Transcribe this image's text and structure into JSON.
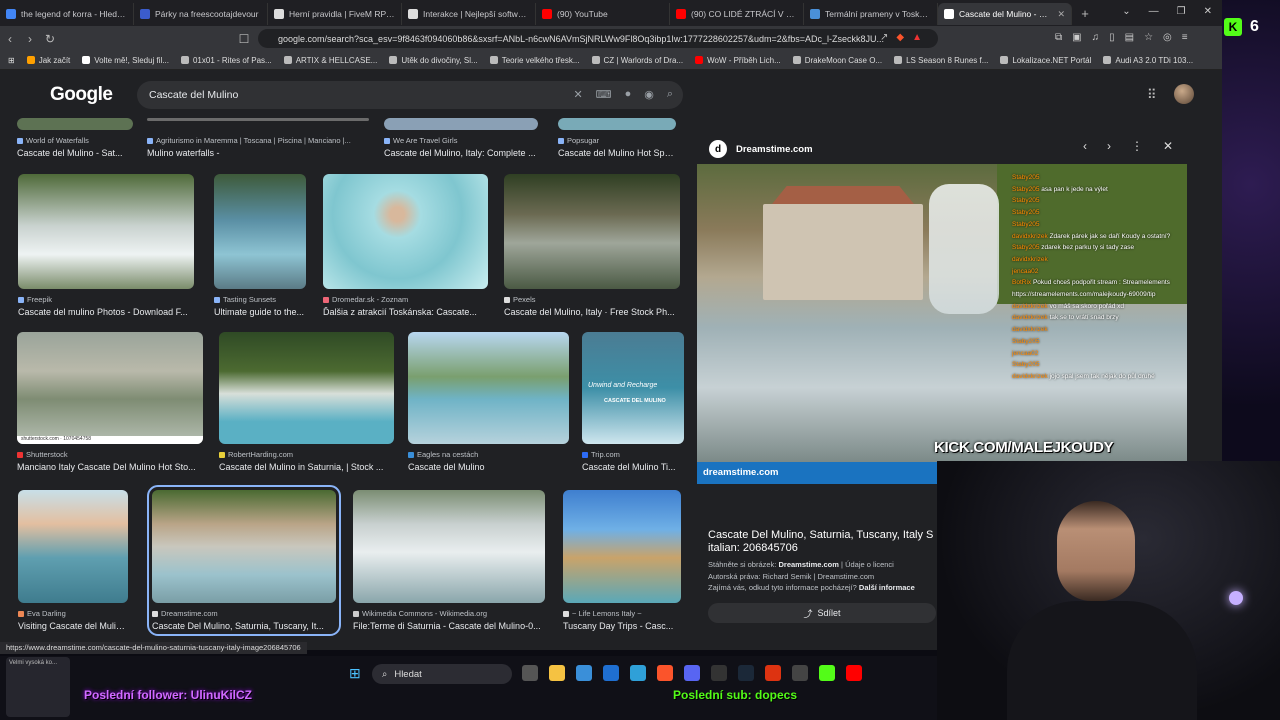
{
  "tabs": [
    {
      "title": "the legend of korra - Hledat G",
      "color": "#4285f4"
    },
    {
      "title": "Párky na freescootajdevour",
      "color": "#3b5ccc"
    },
    {
      "title": "Herní pravidla | FiveM RP - Ge",
      "color": "#dddddd"
    },
    {
      "title": "Interakce | Nejlepší software p",
      "color": "#dddddd"
    },
    {
      "title": "(90) YouTube",
      "color": "#ff0000"
    },
    {
      "title": "(90) CO LIDÉ ZTRÁCÍ V OPUŠT",
      "color": "#ff0000"
    },
    {
      "title": "Termální prameny v Toskánsk",
      "color": "#4a90d9"
    },
    {
      "title": "Cascate del Mulino - Hled",
      "color": "#ffffff",
      "active": true
    }
  ],
  "address": {
    "url": "google.com/search?sca_esv=9f8463f094060b86&sxsrf=ANbL-n6cwN6AVmSjNRLWw9Fl8Oq3ibp1Iw:1777228602257&udm=2&fbs=ADc_l-Zseckk8JU..."
  },
  "bookmarks": [
    "Jak začít",
    "Volte mě!, Sleduj fil...",
    "01x01 - Rites of Pas...",
    "ARTIX & HELLCASE...",
    "Utěk do divočiny, Sl...",
    "Teorie velkého třesk...",
    "CZ | Warlords of Dra...",
    "WoW - Příběh Lich...",
    "DrakeMoon Case O...",
    "LS Season 8 Runes f...",
    "Lokalizace.NET Portál",
    "Audi A3 2.0 TDi 103..."
  ],
  "google": {
    "logo": "Google",
    "query": "Cascate del Mulino"
  },
  "results_top": [
    {
      "source": "World of Waterfalls",
      "title": "Cascate del Mulino - Sat..."
    },
    {
      "source": "Agriturismo in Maremma | Toscana | Piscina | Manciano |...",
      "title": "Mulino waterfalls -"
    },
    {
      "source": "We Are Travel Girls",
      "title": "Cascate del Mulino, Italy: Complete ..."
    },
    {
      "source": "Popsugar",
      "title": "Cascate del Mulino Hot Spri..."
    }
  ],
  "results_row1": [
    {
      "source": "Freepik",
      "title": "Cascate del mulino Photos - Download F..."
    },
    {
      "source": "Tasting Sunsets",
      "title": "Ultimate guide to the..."
    },
    {
      "source": "Dromedar.sk - Zoznam",
      "title": "Ďalšia z atrakcií Toskánska: Cascate..."
    },
    {
      "source": "Pexels",
      "title": "Cascate del Mulino, Italy · Free Stock Ph..."
    }
  ],
  "results_row2": [
    {
      "source": "Shutterstock",
      "title": "Manciano Italy Cascate Del Mulino Hot Sto..."
    },
    {
      "source": "RobertHarding.com",
      "title": "Cascate del Mulino in Saturnia, | Stock ..."
    },
    {
      "source": "Eagles na cestách",
      "title": "Cascate del Mulino"
    },
    {
      "source": "Trip.com",
      "title": "Cascate del Mulino Ti..."
    }
  ],
  "results_row3": [
    {
      "source": "Eva Darling",
      "title": "Visiting Cascate del Mulin..."
    },
    {
      "source": "Dreamstime.com",
      "title": "Cascate Del Mulino, Saturnia, Tuscany, It..."
    },
    {
      "source": "Wikimedia Commons - Wikimedia.org",
      "title": "File:Terme di Saturnia - Cascate del Mulino-0..."
    },
    {
      "source": "~ Life Lemons Italy ~",
      "title": "Tuscany Day Trips - Casc..."
    }
  ],
  "overlay_texts": {
    "tripcom_caption": "Unwind and Recharge",
    "tripcom_caption2": "CASCATE DEL MULINO",
    "shutterstock_mark": "shutterstock.com · 1070454758"
  },
  "preview": {
    "site": "Dreamstime.com",
    "watermark": "dreamstime.com",
    "title": "Cascate Del Mulino, Saturnia, Tuscany, Italy S italian: 206845706",
    "meta1_prefix": "Stáhněte si obrázek:",
    "meta1_site": "Dreamstime.com",
    "meta1_rest": "| Údaje o licenci",
    "meta2": "Autorská práva: Richard Semik | Dreamstime.com",
    "meta3_prefix": "Zajímá vás, odkud tyto informace pocházejí?",
    "meta3_link": "Další informace",
    "share": "Sdílet"
  },
  "chat": [
    {
      "user": "Staby205",
      "msg": ""
    },
    {
      "user": "Staby205",
      "msg": "asa pan k jede na výlet"
    },
    {
      "user": "",
      "msg": ""
    },
    {
      "user": "Staby205",
      "msg": ""
    },
    {
      "user": "Staby205",
      "msg": ""
    },
    {
      "user": "Staby205",
      "msg": ""
    },
    {
      "user": "davidxkrizek",
      "msg": "Zdarek párek jak se daří Koudy a ostatní?"
    },
    {
      "user": "Staby205",
      "msg": "zdarek bez parku ty si tady zase"
    },
    {
      "user": "davidxkrizek",
      "msg": ""
    },
    {
      "user": "jencaa02",
      "msg": ""
    },
    {
      "user": "BotRix",
      "msg": "Pokud chceš podpořit stream : Streamelements"
    },
    {
      "user": "",
      "msg": "https://streamelements.com/malejkoudy-69009/tip"
    },
    {
      "user": "davidxkrizek",
      "msg": "vo máš sa skoro pořád xd"
    },
    {
      "user": "davidxkrizek",
      "msg": "tak se to vrátí snad brzy"
    },
    {
      "user": "davidxkrizek",
      "msg": ""
    },
    {
      "user": "Staby205",
      "msg": ""
    },
    {
      "user": "jencaa02",
      "msg": ""
    },
    {
      "user": "",
      "msg": ""
    },
    {
      "user": "Staby205",
      "msg": ""
    },
    {
      "user": "davidxkrizek",
      "msg": "jojo spal jsem tak nějak do půl druhé"
    }
  ],
  "stream": {
    "kick_label": "KICK.COM/MALEJKOUDY",
    "badge_count": "6",
    "last_follower": "Poslední follower: UlinuKilCZ",
    "last_sub": "Poslední sub: dopecs"
  },
  "status_url": "https://www.dreamstime.com/cascate-del-mulino-saturnia-tuscany-italy-image206845706",
  "taskbar": {
    "search": "Hledat"
  },
  "mini_text": "Velmi vysoká ko..."
}
